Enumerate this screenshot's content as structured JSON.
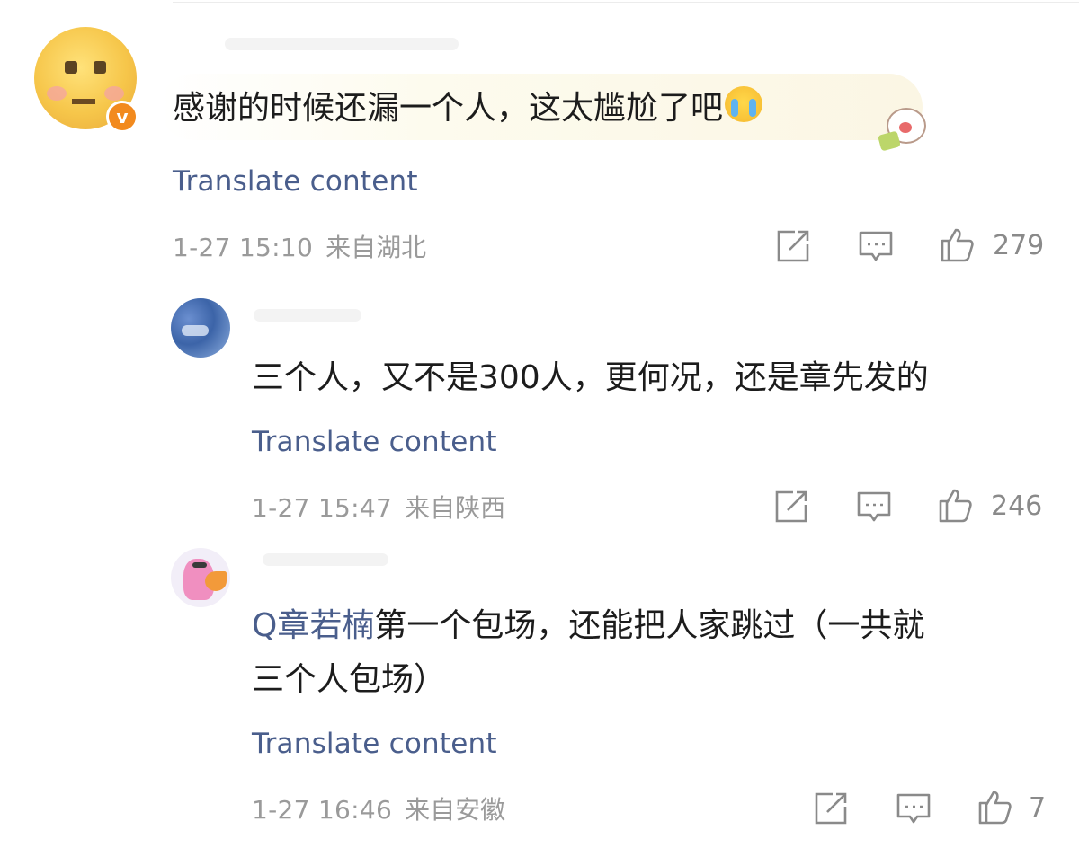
{
  "comments": [
    {
      "text": "感谢的时候还漏一个人，这太尴尬了吧",
      "translate": "Translate content",
      "time": "1-27 15:10",
      "location": "来自湖北",
      "likes": "279"
    },
    {
      "text": "三个人，又不是300人，更何况，还是章先发的",
      "translate": "Translate content",
      "time": "1-27 15:47",
      "location": "来自陕西",
      "likes": "246"
    },
    {
      "mention": "Q章若楠",
      "line1": "第一个包场，还能把人家跳过（一共就",
      "line2": "三个人包场）",
      "translate": "Translate content",
      "time": "1-27 16:46",
      "location": "来自安徽",
      "likes": "7"
    }
  ],
  "icons": {
    "share": "share-icon",
    "comment": "comment-icon",
    "like": "thumbs-up-icon",
    "verified": "verified-badge-icon"
  },
  "colors": {
    "translate_link": "#4a5e8c",
    "meta_gray": "#9a9a9a",
    "badge_orange": "#f28a1e"
  }
}
